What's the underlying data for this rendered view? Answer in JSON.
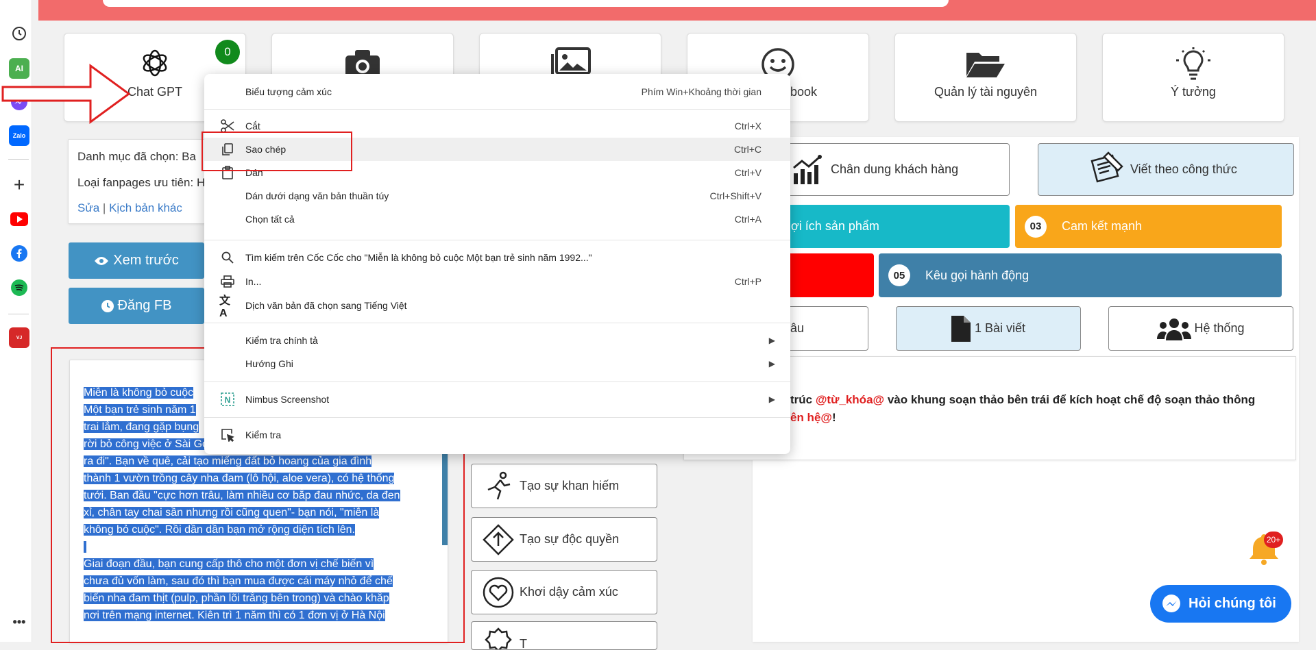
{
  "sidebar": {
    "icons": [
      "history-icon",
      "ai-icon",
      "messenger-icon",
      "zalo-icon",
      "add-icon",
      "youtube-icon",
      "facebook-icon",
      "spotify-icon",
      "vietjet-icon",
      "more-icon"
    ]
  },
  "tools": {
    "chatgpt": {
      "label": "Chat GPT",
      "badge": "0"
    },
    "facebook_partial": "ebook",
    "resources": "Quản lý tài nguyên",
    "ideas": "Ý tưởng"
  },
  "left_panel": {
    "category_label": "Danh mục đã chọn: Ba",
    "fanpage_label": "Loại fanpages ưu tiên: H",
    "edit_link": "Sửa",
    "divider": "|",
    "other_script_link": "Kịch bản khác",
    "preview_button": "Xem trước",
    "post_fb_button": "Đăng FB"
  },
  "editor": {
    "paragraphs": [
      "Miễn là không bỏ cuộc",
      "Một bạn trẻ sinh năm 1",
      "trai lắm, đang gặp bụng",
      "rời bỏ công việc ở Sài Gòn vì thấy \"ai cũng dồn về đó, thì mình",
      "ra đi\". Bạn về quê, cải tạo miếng đất bỏ hoang của gia đình",
      "thành 1 vườn trồng cây nha đam (lô hội, aloe vera), có hệ thống",
      "tưới. Ban đầu \"cực hơn trâu, làm nhiều cơ bắp đau nhức, da đen",
      "xỉ, chân tay chai sần nhưng rồi cũng quen\"- bạn nói, \"miễn là",
      "không bỏ cuộc\". Rồi dần dần bạn mở rộng diện tích lên.",
      "",
      " Giai đoạn đầu, bạn cung cấp thô cho một đơn vị chế biến vì",
      "chưa đủ vốn làm, sau đó thì bạn mua được cái máy nhỏ để chế",
      "biến nha đam thịt (pulp, phần lõi trắng bên trong) và chào khắp",
      "nơi trên mạng internet. Kiên trì 1 năm thì có 1 đơn vị ở Hà Nội"
    ]
  },
  "techniques": {
    "scarcity": "Tạo sự khan hiếm",
    "exclusivity": "Tạo sự độc quyền",
    "emotion": "Khơi dậy cảm xúc",
    "partial": "T"
  },
  "right_panel": {
    "customer_portrait": "Chân dung khách hàng",
    "write_formula": "Viết theo công thức",
    "benefit": "ợi ích sản phẩm",
    "commitment_num": "03",
    "commitment": "Cam kết mạnh",
    "cta_num": "05",
    "cta": "Kêu gọi hành động",
    "tab_partial": "âu",
    "tab_one_post": "1 Bài viết",
    "tab_system": "Hệ thống",
    "instruction_pre": "trúc ",
    "instruction_kw": "@từ_khóa@",
    "instruction_post": " vào khung soạn thảo bên trái để kích hoạt chế độ soạn thảo thông",
    "instruction_kw2": "ên hệ@",
    "instruction_end": "!",
    "bell_badge": "20+",
    "chat_button": "Hỏi chúng tôi"
  },
  "context_menu": {
    "emoji": {
      "label": "Biểu tượng cảm xúc",
      "shortcut": "Phím Win+Khoảng thời gian"
    },
    "cut": {
      "label": "Cắt",
      "shortcut": "Ctrl+X"
    },
    "copy": {
      "label": "Sao chép",
      "shortcut": "Ctrl+C"
    },
    "paste": {
      "label": "Dán",
      "shortcut": "Ctrl+V"
    },
    "paste_plain": {
      "label": "Dán dưới dạng văn bản thuần túy",
      "shortcut": "Ctrl+Shift+V"
    },
    "select_all": {
      "label": "Chọn tất cả",
      "shortcut": "Ctrl+A"
    },
    "search": {
      "label": "Tìm kiếm trên Cốc Cốc cho \"Miễn là không bỏ cuộc  Một bạn trẻ sinh năm 1992...\""
    },
    "print": {
      "label": "In...",
      "shortcut": "Ctrl+P"
    },
    "translate": {
      "label": "Dịch văn bản đã chọn sang Tiếng Việt"
    },
    "spellcheck": {
      "label": "Kiểm tra chính tả"
    },
    "direction": {
      "label": "Hướng Ghi"
    },
    "nimbus": {
      "label": "Nimbus Screenshot"
    },
    "inspect": {
      "label": "Kiểm tra"
    }
  },
  "colors": {
    "accent_red": "#e02020",
    "blue_btn": "#4293c4",
    "cyan": "#17b9c8",
    "orange": "#f9a61a",
    "red": "#ff0000",
    "steel": "#3f80a8",
    "messenger": "#1877f2"
  }
}
